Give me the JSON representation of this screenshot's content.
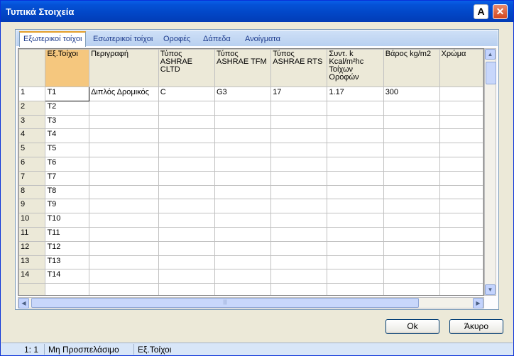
{
  "window": {
    "title": "Τυπικά Στοιχεία",
    "help_label": "A",
    "close_label": "✕"
  },
  "tabs": [
    "Εξωτερικοί τοίχοι",
    "Εσωτερικοί τοίχοι",
    "Οροφές",
    "Δάπεδα",
    "Ανοίγματα"
  ],
  "grid": {
    "columns": [
      "Εξ.Τοίχοι",
      "Περιγραφή",
      "Τύπος ASHRAE CLTD",
      "Τύπος ASHRAE TFM",
      "Τύπος ASHRAE RTS",
      "Συντ. k Kcal/m²hc Τοίχων Οροφών",
      "Βάρος kg/m2",
      "Χρώμα"
    ],
    "rows": [
      [
        "1",
        "T1",
        "Διπλός Δρομικός",
        "C",
        "G3",
        "17",
        "1.17",
        "300",
        ""
      ],
      [
        "2",
        "T2",
        "",
        "",
        "",
        "",
        "",
        "",
        ""
      ],
      [
        "3",
        "T3",
        "",
        "",
        "",
        "",
        "",
        "",
        ""
      ],
      [
        "4",
        "T4",
        "",
        "",
        "",
        "",
        "",
        "",
        ""
      ],
      [
        "5",
        "T5",
        "",
        "",
        "",
        "",
        "",
        "",
        ""
      ],
      [
        "6",
        "T6",
        "",
        "",
        "",
        "",
        "",
        "",
        ""
      ],
      [
        "7",
        "T7",
        "",
        "",
        "",
        "",
        "",
        "",
        ""
      ],
      [
        "8",
        "T8",
        "",
        "",
        "",
        "",
        "",
        "",
        ""
      ],
      [
        "9",
        "T9",
        "",
        "",
        "",
        "",
        "",
        "",
        ""
      ],
      [
        "10",
        "T10",
        "",
        "",
        "",
        "",
        "",
        "",
        ""
      ],
      [
        "11",
        "T11",
        "",
        "",
        "",
        "",
        "",
        "",
        ""
      ],
      [
        "12",
        "T12",
        "",
        "",
        "",
        "",
        "",
        "",
        ""
      ],
      [
        "13",
        "T13",
        "",
        "",
        "",
        "",
        "",
        "",
        ""
      ],
      [
        "14",
        "T14",
        "",
        "",
        "",
        "",
        "",
        "",
        ""
      ],
      [
        "",
        "",
        "",
        "",
        "",
        "",
        "",
        "",
        ""
      ]
    ]
  },
  "buttons": {
    "ok": "Ok",
    "cancel": "Άκυρο"
  },
  "status": {
    "position": "1: 1",
    "mode": "Μη Προσπελάσιμο",
    "context": "Εξ.Τοίχοι"
  },
  "icons": {
    "scroll_up": "chevron-up-icon",
    "scroll_down": "chevron-down-icon",
    "scroll_left": "chevron-left-icon",
    "scroll_right": "chevron-right-icon"
  },
  "colors": {
    "title_bar": "#0451d6",
    "selected_header": "#f5c77e",
    "status_bar": "#d8e6f8"
  }
}
